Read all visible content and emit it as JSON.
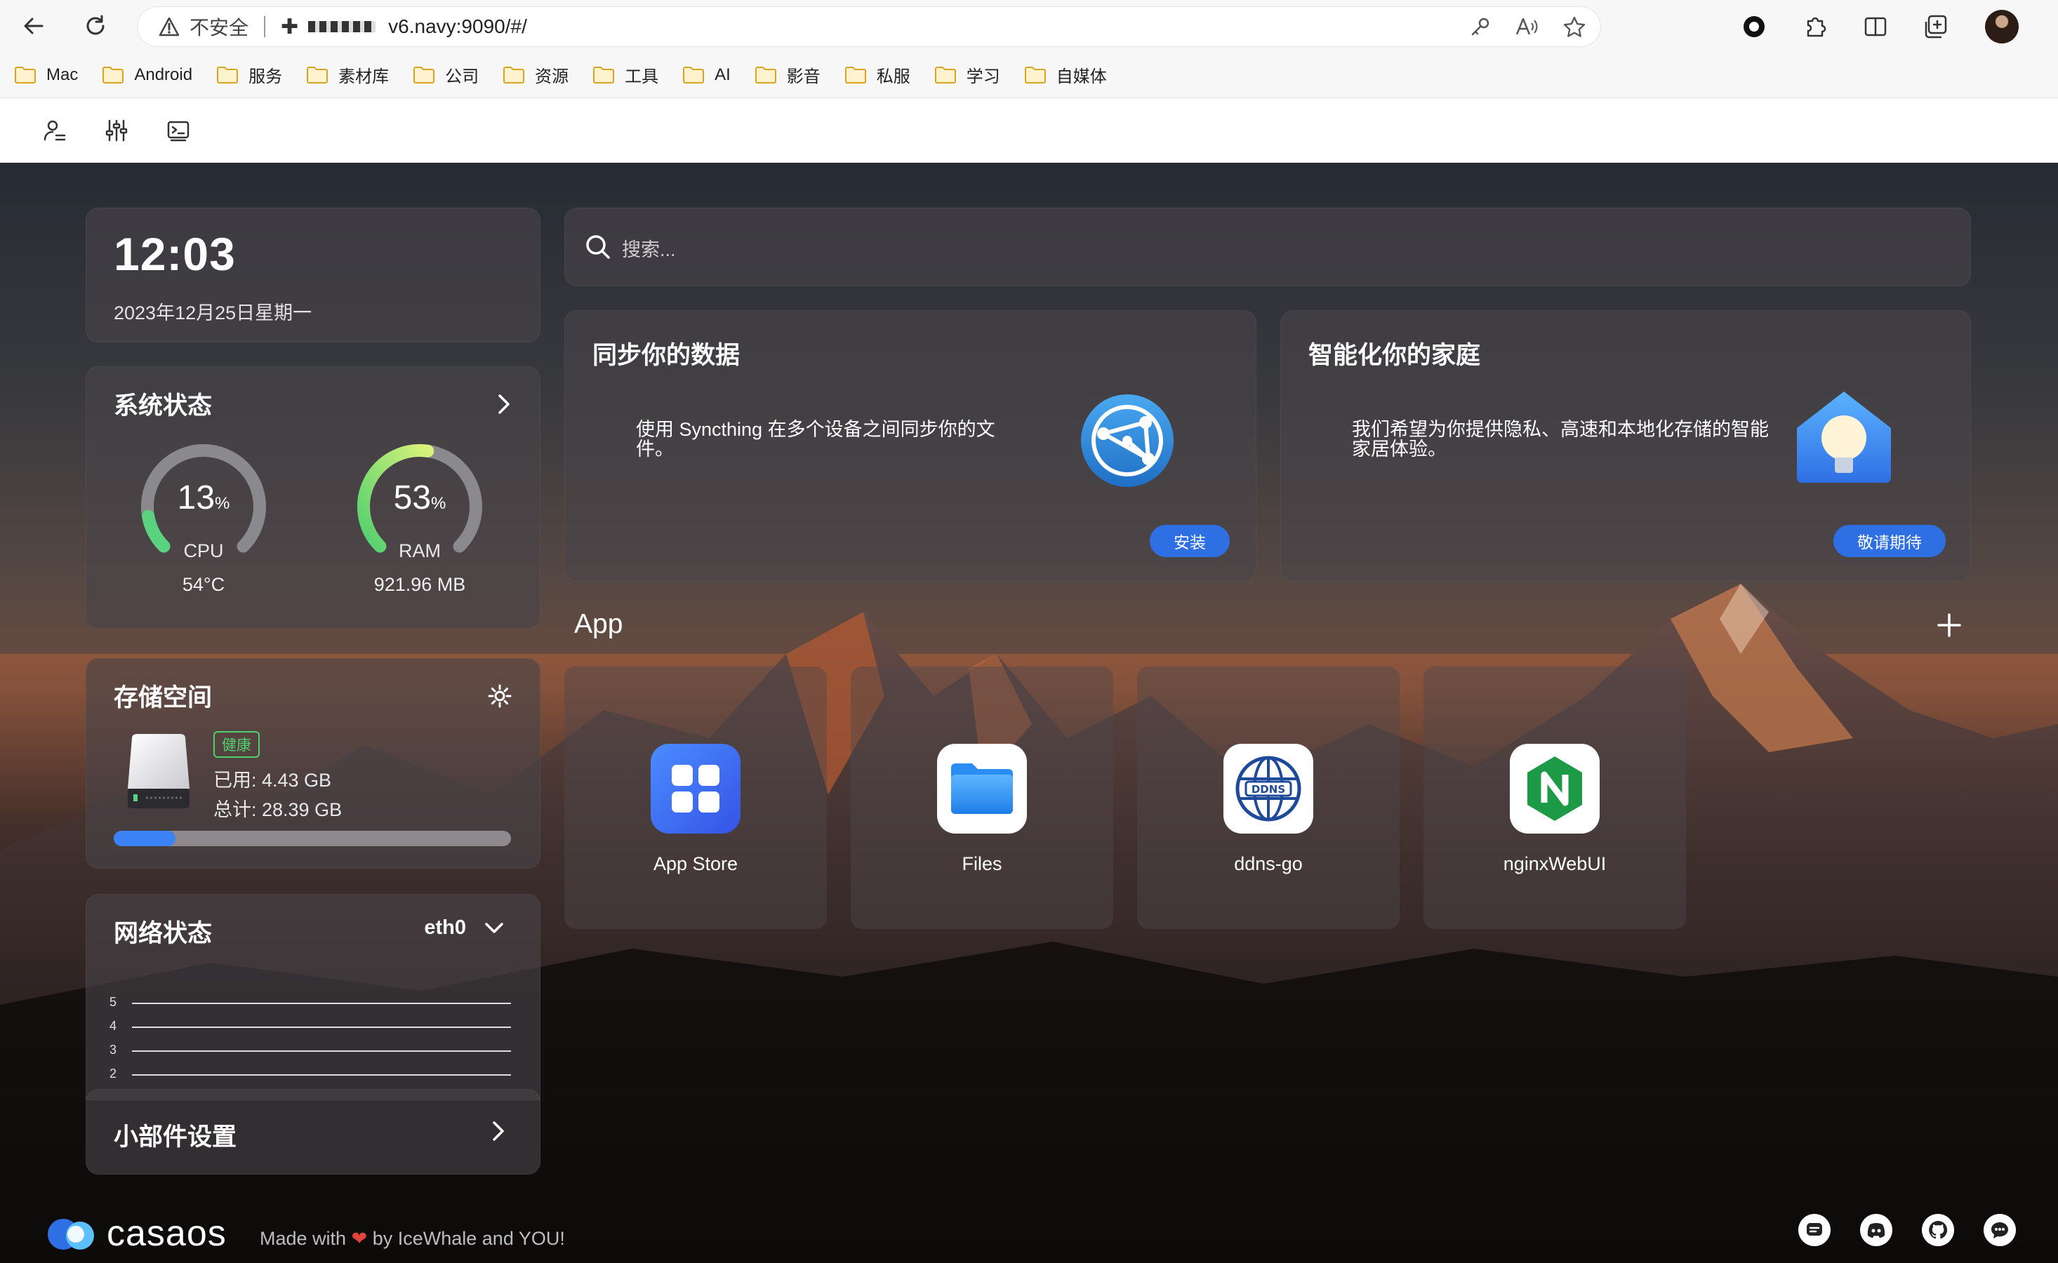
{
  "browser": {
    "security_label": "不安全",
    "url": "v6.navy:9090/#/",
    "bookmarks": [
      "Mac",
      "Android",
      "服务",
      "素材库",
      "公司",
      "资源",
      "工具",
      "AI",
      "影音",
      "私服",
      "学习",
      "自媒体"
    ]
  },
  "clock": {
    "time": "12:03",
    "date": "2023年12月25日星期一"
  },
  "system_status": {
    "title": "系统状态",
    "cpu": {
      "value": "13",
      "unit": "%",
      "label": "CPU",
      "sub": "54°C",
      "percent": 13
    },
    "ram": {
      "value": "53",
      "unit": "%",
      "label": "RAM",
      "sub": "921.96 MB",
      "percent": 53
    }
  },
  "storage": {
    "title": "存储空间",
    "health": "健康",
    "used": "已用: 4.43 GB",
    "total": "总计: 28.39 GB",
    "used_fraction": 0.156
  },
  "network": {
    "title": "网络状态",
    "interface": "eth0",
    "ticks": [
      "5",
      "4",
      "3",
      "2"
    ]
  },
  "widget_settings": {
    "title": "小部件设置"
  },
  "search": {
    "placeholder": "搜索..."
  },
  "features": [
    {
      "title": "同步你的数据",
      "description": "使用 Syncthing 在多个设备之间同步你的文件。",
      "button": "安装"
    },
    {
      "title": "智能化你的家庭",
      "description": "我们希望为你提供隐私、高速和本地化存储的智能家居体验。",
      "button": "敬请期待"
    }
  ],
  "apps_section": {
    "title": "App",
    "items": [
      {
        "name": "App Store",
        "icon": "app-store-icon",
        "color": "#3b6df0"
      },
      {
        "name": "Files",
        "icon": "folder-icon",
        "color": "#ffffff"
      },
      {
        "name": "ddns-go",
        "icon": "ddns-globe-icon",
        "color": "#ffffff"
      },
      {
        "name": "nginxWebUI",
        "icon": "nginx-icon",
        "color": "#ffffff"
      }
    ]
  },
  "footer": {
    "logo_text": "casaos",
    "made_with_prefix": "Made with",
    "made_with_suffix": "by IceWhale and YOU!"
  },
  "colors": {
    "accent": "#2f6fe4",
    "health": "#4fcf6e",
    "gauge_fill": "#5ad27f"
  }
}
